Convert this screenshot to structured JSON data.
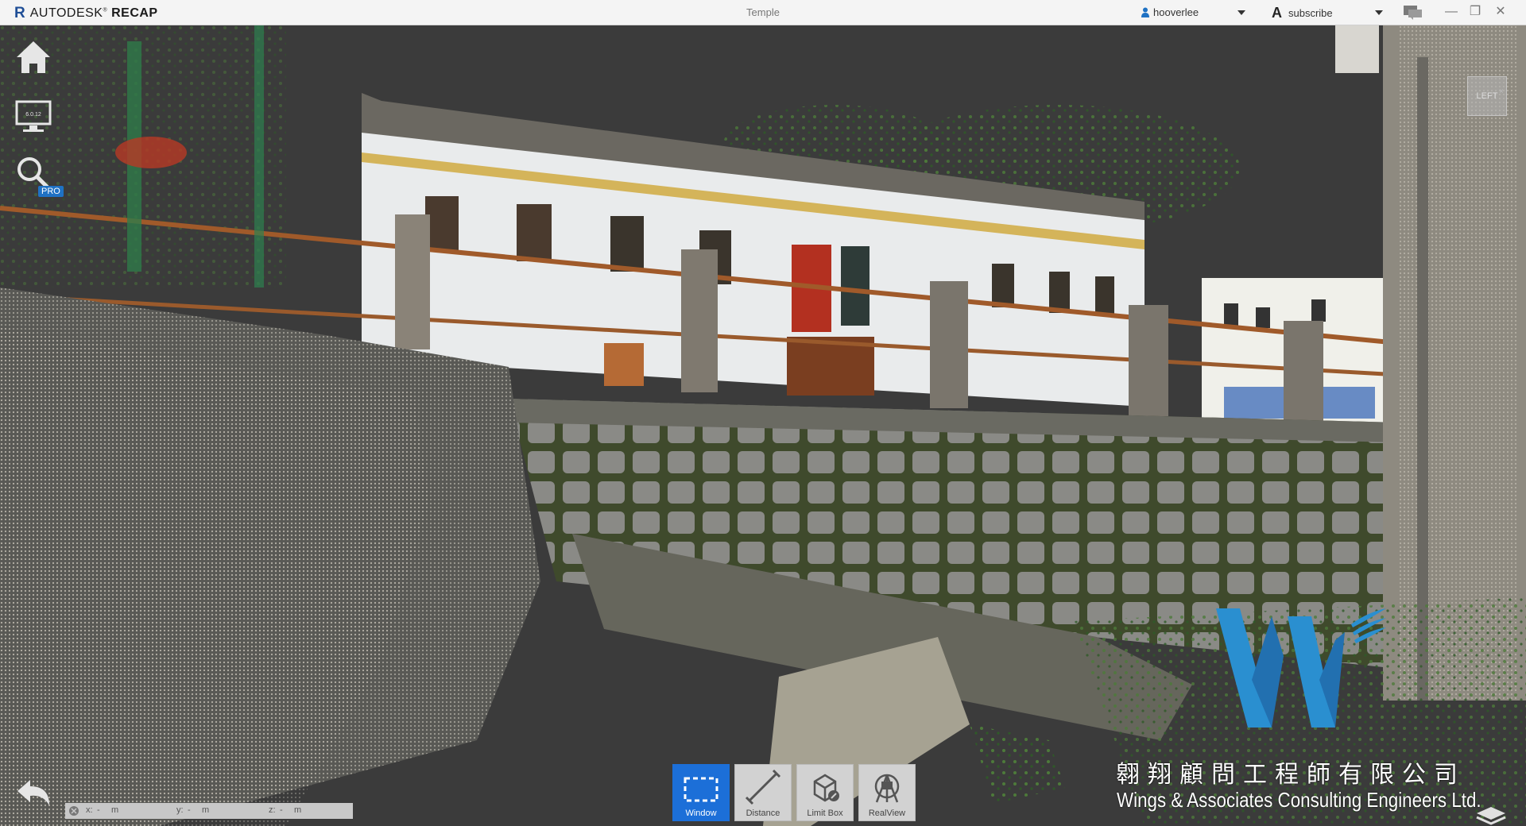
{
  "app": {
    "brand_prefix": "AUTODESK",
    "brand_name": "RECAP",
    "document_title": "Temple"
  },
  "account": {
    "username": "hooverlee",
    "subscribe_label": "subscribe"
  },
  "left_nav": {
    "pro_badge": "PRO",
    "display_version": "6.0.12"
  },
  "viewcube": {
    "face_label": "LEFT",
    "close_glyph": "×"
  },
  "toolbar": {
    "items": [
      {
        "label": "Window",
        "active": true
      },
      {
        "label": "Distance",
        "active": false
      },
      {
        "label": "Limit Box",
        "active": false
      },
      {
        "label": "RealView",
        "active": false
      }
    ]
  },
  "coordinates": {
    "x_label": "x:",
    "x_value": "-",
    "x_unit": "m",
    "y_label": "y:",
    "y_value": "-",
    "y_unit": "m",
    "z_label": "z:",
    "z_value": "-",
    "z_unit": "m"
  },
  "watermark": {
    "chinese": "翱翔顧問工程師有限公司",
    "english": "Wings & Associates Consulting Engineers Ltd."
  },
  "colors": {
    "accent": "#1c6fd8",
    "logo_blue": "#2a8fd0",
    "titlebar": "#f4f4f4"
  }
}
